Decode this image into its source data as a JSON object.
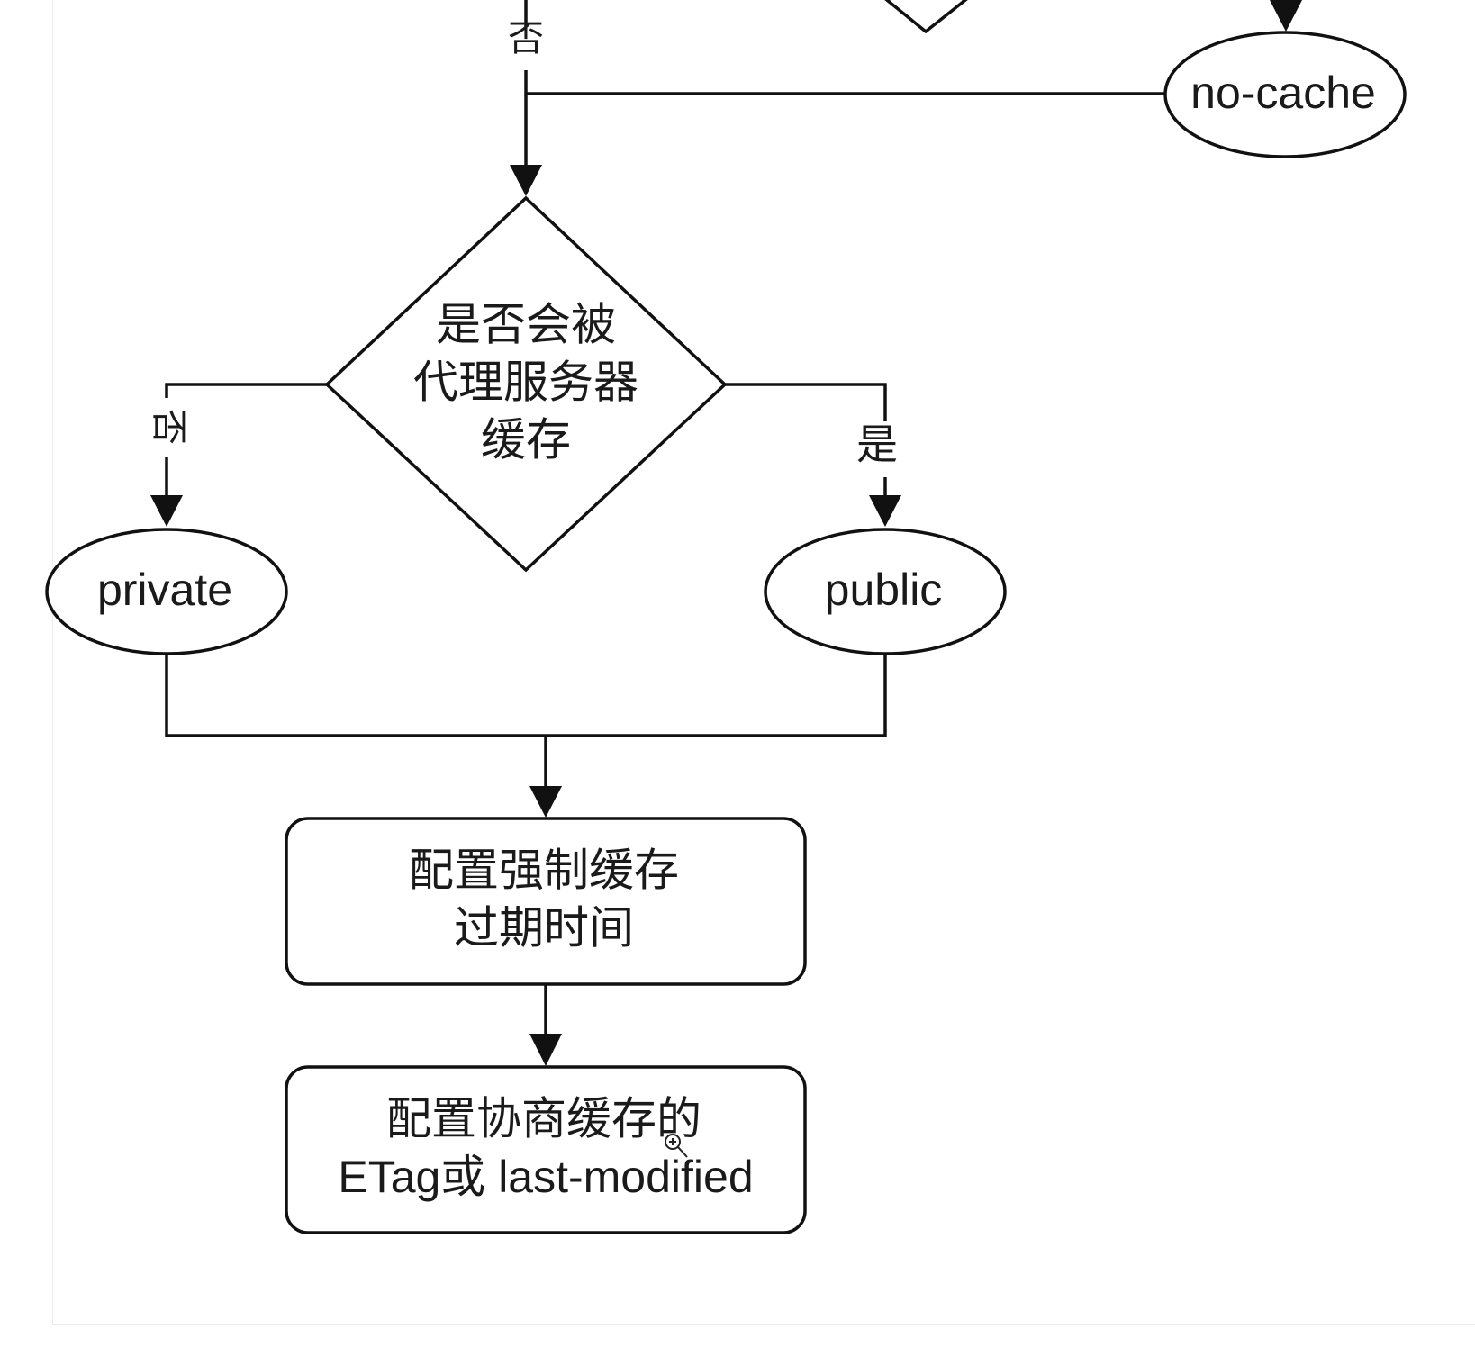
{
  "diagram": {
    "edge_labels": {
      "top_no": "否",
      "left_no": "否",
      "right_yes": "是"
    },
    "nodes": {
      "no_cache": "no-cache",
      "proxy_decision": {
        "line1": "是否会被",
        "line2": "代理服务器",
        "line3": "缓存"
      },
      "private": "private",
      "public": "public",
      "strong_cache": {
        "line1": "配置强制缓存",
        "line2": "过期时间"
      },
      "negotiated_cache": {
        "line1": "配置协商缓存的",
        "line2": "ETag或 last-modified"
      }
    }
  }
}
